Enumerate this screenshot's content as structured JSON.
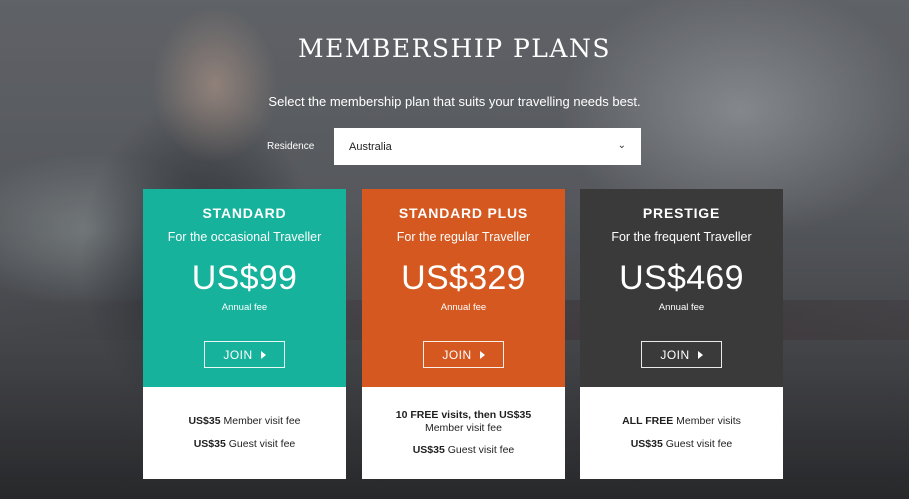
{
  "page": {
    "title": "MEMBERSHIP PLANS",
    "subtitle": "Select the membership plan that suits your travelling needs best."
  },
  "residence": {
    "label": "Residence",
    "selected": "Australia"
  },
  "plans": [
    {
      "name": "STANDARD",
      "tagline": "For the occasional Traveller",
      "price": "US$99",
      "fee_label": "Annual fee",
      "join_label": "JOIN",
      "color": "#17b29c",
      "lines": [
        {
          "bold": "US$35",
          "text": " Member visit fee"
        },
        {
          "bold": "US$35",
          "text": " Guest visit fee"
        }
      ]
    },
    {
      "name": "STANDARD PLUS",
      "tagline": "For the regular Traveller",
      "price": "US$329",
      "fee_label": "Annual fee",
      "join_label": "JOIN",
      "color": "#d4581f",
      "lines": [
        {
          "bold": "10 FREE visits, then US$35",
          "text": "Member visit fee"
        },
        {
          "bold": "US$35",
          "text": " Guest visit fee"
        }
      ]
    },
    {
      "name": "PRESTIGE",
      "tagline": "For the frequent Traveller",
      "price": "US$469",
      "fee_label": "Annual fee",
      "join_label": "JOIN",
      "color": "#3b3a3b",
      "lines": [
        {
          "bold": "ALL FREE",
          "text": " Member visits"
        },
        {
          "bold": "US$35",
          "text": " Guest visit fee"
        }
      ]
    }
  ]
}
